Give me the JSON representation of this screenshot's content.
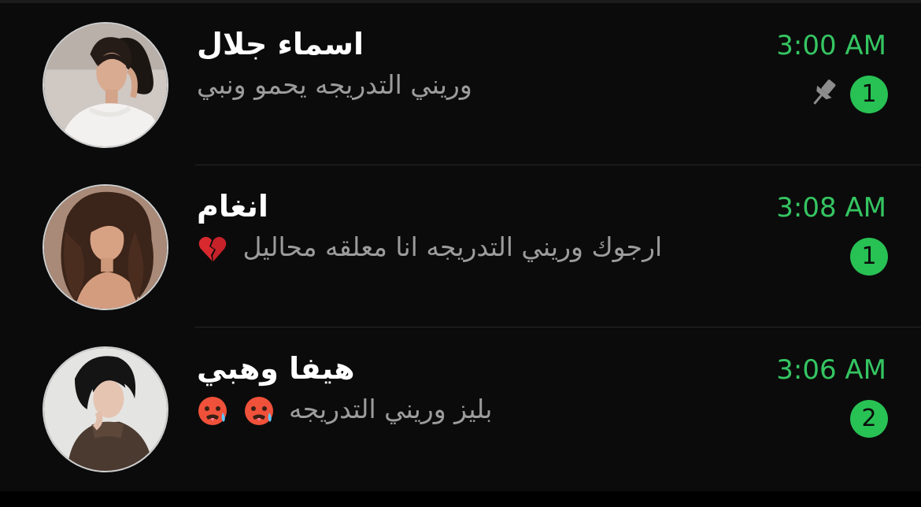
{
  "chats": [
    {
      "name": "اسماء جلال",
      "preview": "وريني التدريجه يحمو ونبي",
      "time": "3:00 AM",
      "unread": "1",
      "pinned": true,
      "avatar_icon": "avatar-woman-white-dress"
    },
    {
      "name": "انغام",
      "preview": "ارجوك وريني التدريجه انا معلقه محاليل",
      "time": "3:08 AM",
      "unread": "1",
      "pinned": false,
      "emoji": "broken-heart-icon",
      "avatar_icon": "avatar-woman-curly-hair"
    },
    {
      "name": "هيفا وهبي",
      "preview": "بليز وريني التدريجه",
      "time": "3:06 AM",
      "unread": "2",
      "pinned": false,
      "emoji": "hot-face-icon",
      "avatar_icon": "avatar-woman-leather-jacket"
    }
  ],
  "colors": {
    "background": "#0b0b0b",
    "accent_green": "#35c562",
    "badge_green": "#28c154",
    "name_text": "#ffffff",
    "preview_text": "#9c9c9c"
  }
}
